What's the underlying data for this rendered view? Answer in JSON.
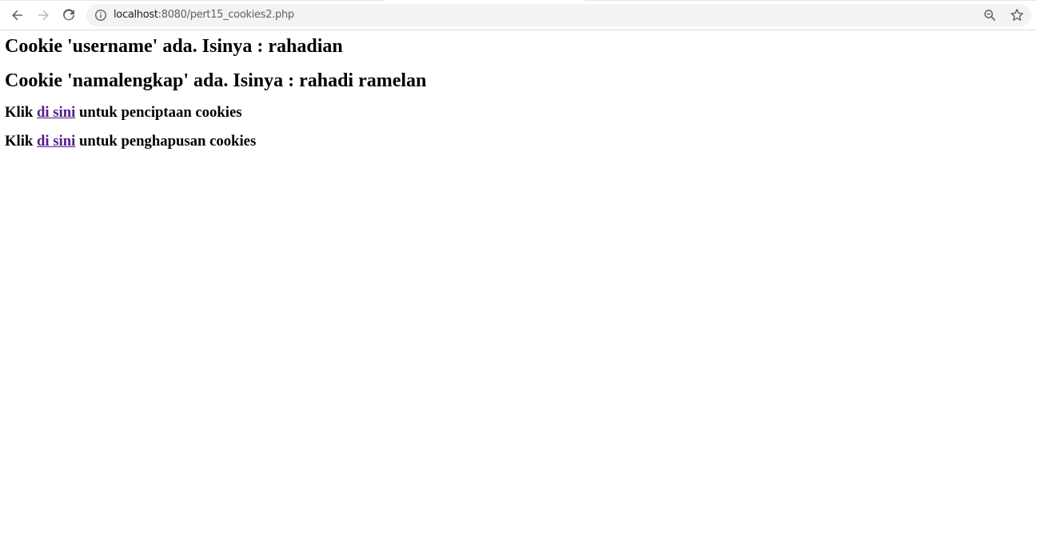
{
  "browser": {
    "url_host": "localhost",
    "url_rest": ":8080/pert15_cookies2.php",
    "icons": {
      "back": "back-arrow-icon",
      "forward": "forward-arrow-icon",
      "reload": "reload-icon",
      "info": "info-icon",
      "zoom": "zoom-icon",
      "bookmark": "star-icon"
    }
  },
  "page": {
    "cookie_username": "Cookie 'username' ada. Isinya : rahadian",
    "cookie_namalengkap": "Cookie 'namalengkap' ada. Isinya : rahadi ramelan",
    "create_line": {
      "prefix": "Klik ",
      "link": "di sini",
      "suffix": " untuk penciptaan cookies"
    },
    "delete_line": {
      "prefix": "Klik ",
      "link": "di sini",
      "suffix": " untuk penghapusan cookies"
    },
    "link_color": "#551a8b"
  }
}
